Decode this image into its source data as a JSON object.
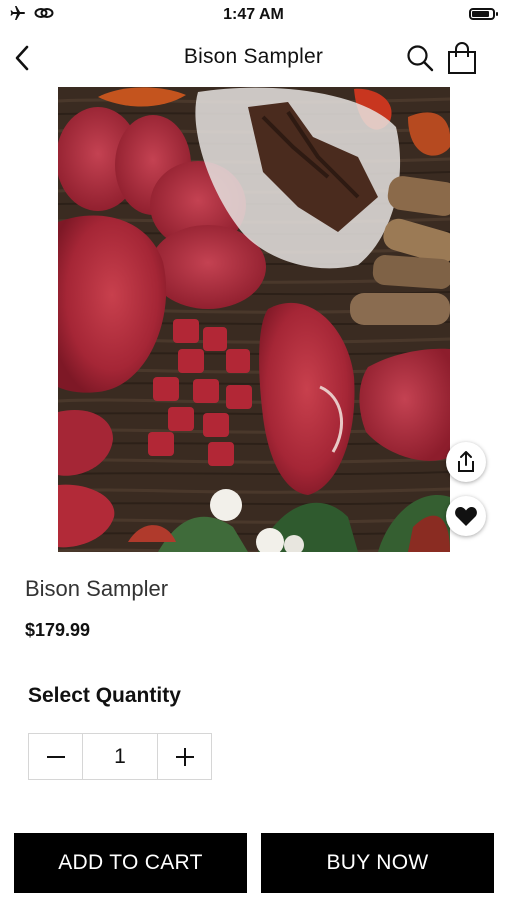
{
  "status_bar": {
    "time": "1:47 AM",
    "icons": [
      "airplane-icon",
      "link-icon",
      "battery-icon"
    ],
    "battery_level": 0.75
  },
  "header": {
    "title": "Bison Sampler",
    "icons": [
      "back-chevron-icon",
      "search-icon",
      "shopping-bag-icon"
    ]
  },
  "product": {
    "image_subject": "assorted raw bison meats: burger patties, steak, cubed stew meat, jerky, sausage sticks and ground meat on a wooden board",
    "name": "Bison Sampler",
    "price": "$179.99",
    "actions": [
      "share-icon",
      "heart-icon"
    ]
  },
  "quantity": {
    "label": "Select Quantity",
    "value": "1",
    "decrement_icon": "minus-icon",
    "increment_icon": "plus-icon"
  },
  "buttons": {
    "add_to_cart": "ADD TO CART",
    "buy_now": "BUY NOW"
  },
  "colors": {
    "primary_button": "#000000",
    "button_text": "#ffffff",
    "border": "#d6d6d6"
  }
}
